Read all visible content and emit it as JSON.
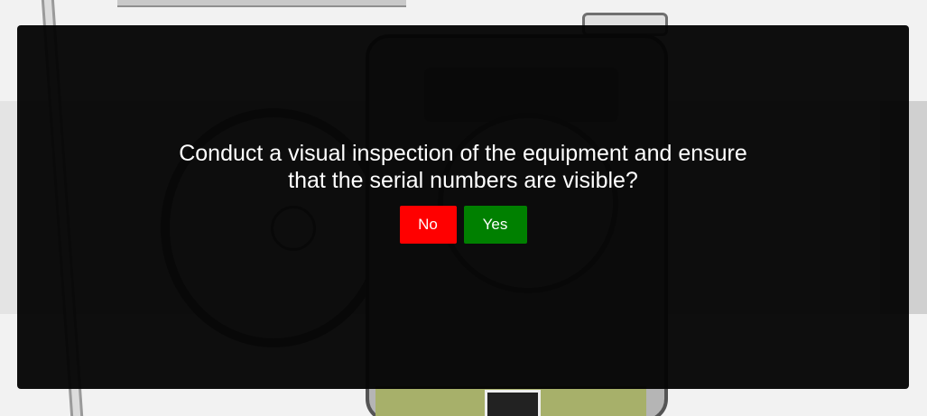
{
  "dialog": {
    "question_line1": "Conduct a visual inspection of the equipment and ensure",
    "question_line2": "that the serial numbers are visible?",
    "no_label": "No",
    "yes_label": "Yes"
  },
  "colors": {
    "no_button": "#ff0000",
    "yes_button": "#008000",
    "overlay": "#040404"
  }
}
